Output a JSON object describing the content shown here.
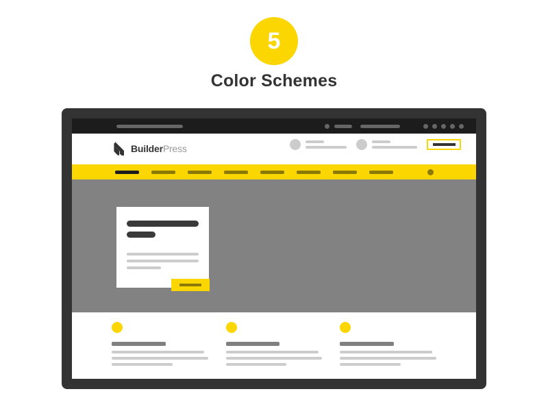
{
  "header": {
    "badge_number": "5",
    "title": "Color Schemes",
    "badge_color": "#fbd600",
    "title_color": "#333333"
  },
  "mockup": {
    "frame_color": "#333333",
    "browser_bar": {
      "name": "browser-chrome",
      "background": "#1c1c1c",
      "url_placeholder_width": 97,
      "left_dot": true,
      "pills": [
        26,
        58
      ],
      "right_dots": 5,
      "element_color": "#666666"
    },
    "site_header": {
      "brand": {
        "name": "BuilderPress",
        "bold_part": "Builder",
        "light_part": "Press",
        "mark": "builderpress-logo-icon"
      },
      "right_items": [
        {
          "avatar": true,
          "line_short": true,
          "line_long": true
        },
        {
          "avatar": true,
          "line_short": true,
          "line_long": true
        }
      ],
      "cta_button": {
        "name": "header-cta-button",
        "border_color": "#fbd600",
        "bar_color": "#333333"
      }
    },
    "nav": {
      "background": "#fbd600",
      "items": [
        {
          "active": true
        },
        {
          "active": false
        },
        {
          "active": false
        },
        {
          "active": false
        },
        {
          "active": false
        },
        {
          "active": false
        },
        {
          "active": false
        },
        {
          "active": false
        }
      ],
      "active_color": "#1c1c1c",
      "inactive_color": "#8c7a06",
      "search_dot": true
    },
    "hero": {
      "background": "#828282",
      "card": {
        "background": "#ffffff",
        "heading_bars": 2,
        "text_lines": 3,
        "heading_color": "#3a3a3a",
        "text_color": "#cccccc"
      },
      "button": {
        "name": "hero-cta-button",
        "background": "#fbd600",
        "bar_color": "#8c7a06"
      }
    },
    "features": {
      "background": "#ffffff",
      "dot_color": "#fbd600",
      "title_color": "#808080",
      "line_color": "#cccccc",
      "columns": [
        {
          "dot": true,
          "title": true,
          "lines": 3
        },
        {
          "dot": true,
          "title": true,
          "lines": 3
        },
        {
          "dot": true,
          "title": true,
          "lines": 3
        }
      ]
    }
  }
}
